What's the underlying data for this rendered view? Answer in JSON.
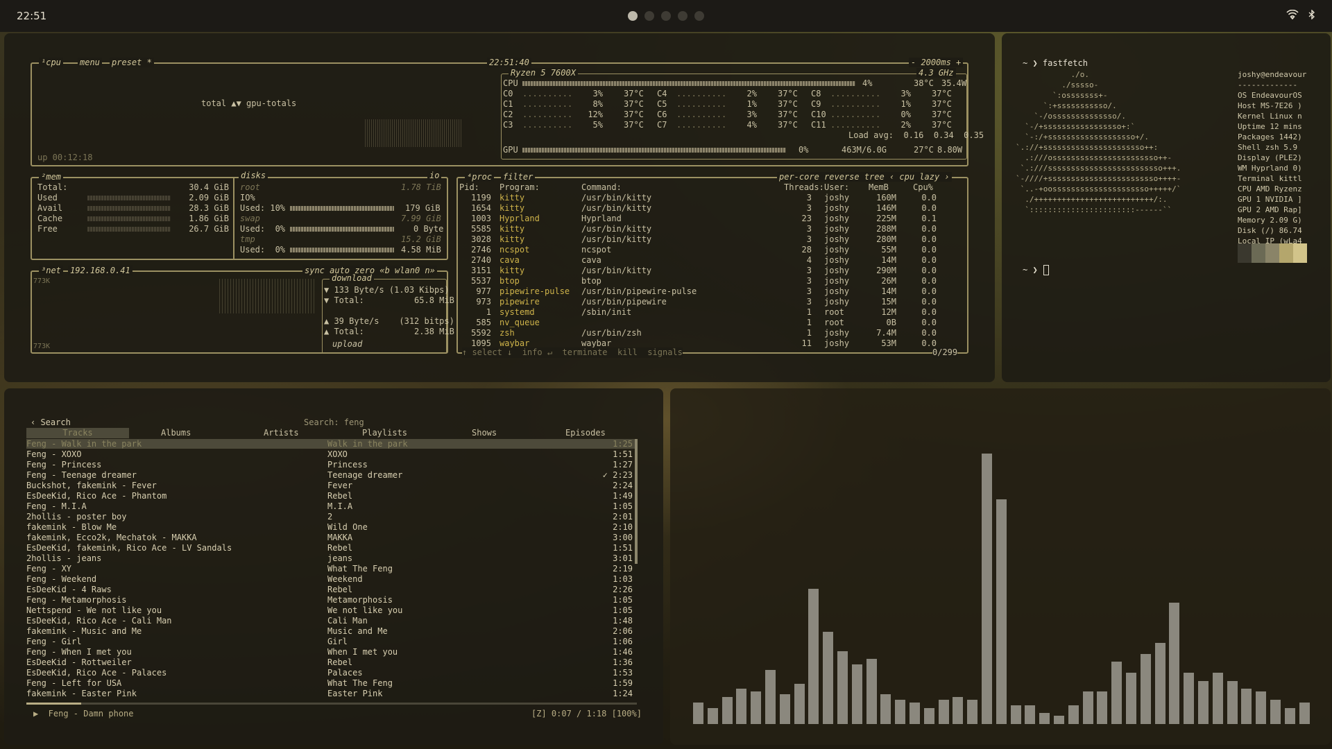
{
  "topbar": {
    "clock": "22:51",
    "workspaces": [
      true,
      false,
      false,
      false,
      false
    ],
    "tray": {
      "wifi": "wifi-icon",
      "bluetooth": "bluetooth-icon"
    }
  },
  "btop": {
    "cpu_tab": "¹cpu",
    "menu_tab": "menu",
    "preset_tab": "preset *",
    "clock": "22:51:40",
    "interval": "- 2000ms +",
    "cpu_model": "Ryzen 5 7600X",
    "freq": "4.3 GHz",
    "uptime": "up 00:12:18",
    "graph_label": "total ▲▼ gpu-totals",
    "cpu_total": {
      "label": "CPU",
      "pct": "4%",
      "temp": "38°C",
      "power": "35.4W",
      "fill": 0.04
    },
    "cores": [
      [
        "C0",
        "3%",
        "37°C"
      ],
      [
        "C1",
        "8%",
        "37°C"
      ],
      [
        "C2",
        "12%",
        "37°C"
      ],
      [
        "C3",
        "5%",
        "37°C"
      ],
      [
        "C4",
        "2%",
        "37°C"
      ],
      [
        "C5",
        "1%",
        "37°C"
      ],
      [
        "C6",
        "3%",
        "37°C"
      ],
      [
        "C7",
        "4%",
        "37°C"
      ],
      [
        "C8",
        "3%",
        "37°C"
      ],
      [
        "C9",
        "1%",
        "37°C"
      ],
      [
        "C10",
        "0%",
        "37°C"
      ],
      [
        "C11",
        "2%",
        "37°C"
      ]
    ],
    "load_avg": "Load avg:  0.16  0.34  0.35",
    "gpu": {
      "label": "GPU",
      "pct": "0%",
      "mem": "463M/6.0G",
      "temp": "27°C",
      "power": "8.80W"
    },
    "mem": {
      "title": "²mem",
      "rows": [
        [
          "Total:",
          "30.4 GiB"
        ],
        [
          "Used",
          "2.09 GiB"
        ],
        [
          "Avail",
          "28.3 GiB"
        ],
        [
          "Cache",
          "1.86 GiB"
        ],
        [
          "Free",
          "26.7 GiB"
        ]
      ]
    },
    "disks": {
      "title": "disks",
      "io": "io",
      "root": "root",
      "root_size": "1.78 TiB",
      "io_label": "IO%",
      "root_used": "Used: 10%",
      "root_used_val": "179 GiB",
      "swap": "swap",
      "swap_size": "7.99 GiB",
      "swap_used": "Used:  0%",
      "swap_used_val": "0 Byte",
      "tmp": "tmp",
      "tmp_size": "15.2 GiB",
      "tmp_used": "Used:  0%",
      "tmp_used_val": "4.58 MiB"
    },
    "net": {
      "title": "³net",
      "ip": "192.168.0.41",
      "tabs": "sync auto zero «b wlan0 n»",
      "scale_top": "773K",
      "scale_bot": "773K",
      "download": "download",
      "dl_rate": "▼ 133 Byte/s (1.03 Kibps)",
      "dl_total": "▼ Total:          65.8 MiB",
      "ul_rate": "▲ 39 Byte/s    (312 bitps)",
      "ul_total": "▲ Total:          2.38 MiB",
      "upload": "upload"
    },
    "proc": {
      "title": "⁴proc",
      "filter": "filter",
      "opts": "per-core  reverse  tree  ‹ cpu lazy ›",
      "headers": [
        "Pid:",
        "Program:",
        "Command:",
        "Threads:",
        "User:",
        "MemB",
        "Cpu%"
      ],
      "rows": [
        [
          "1199",
          "kitty",
          "/usr/bin/kitty",
          "3",
          "joshy",
          "160M",
          "0.0"
        ],
        [
          "1654",
          "kitty",
          "/usr/bin/kitty",
          "3",
          "joshy",
          "146M",
          "0.0"
        ],
        [
          "1003",
          "Hyprland",
          "Hyprland",
          "23",
          "joshy",
          "225M",
          "0.1"
        ],
        [
          "5585",
          "kitty",
          "/usr/bin/kitty",
          "3",
          "joshy",
          "288M",
          "0.0"
        ],
        [
          "3028",
          "kitty",
          "/usr/bin/kitty",
          "3",
          "joshy",
          "280M",
          "0.0"
        ],
        [
          "2746",
          "ncspot",
          "ncspot",
          "28",
          "joshy",
          "55M",
          "0.0"
        ],
        [
          "2740",
          "cava",
          "cava",
          "4",
          "joshy",
          "14M",
          "0.0"
        ],
        [
          "3151",
          "kitty",
          "/usr/bin/kitty",
          "3",
          "joshy",
          "290M",
          "0.0"
        ],
        [
          "5537",
          "btop",
          "btop",
          "3",
          "joshy",
          "26M",
          "0.0"
        ],
        [
          "977",
          "pipewire-pulse",
          "/usr/bin/pipewire-pulse",
          "3",
          "joshy",
          "14M",
          "0.0"
        ],
        [
          "973",
          "pipewire",
          "/usr/bin/pipewire",
          "3",
          "joshy",
          "15M",
          "0.0"
        ],
        [
          "1",
          "systemd",
          "/sbin/init",
          "1",
          "root",
          "12M",
          "0.0"
        ],
        [
          "585",
          "nv_queue",
          "",
          "1",
          "root",
          "0B",
          "0.0"
        ],
        [
          "5592",
          "zsh",
          "/usr/bin/zsh",
          "1",
          "joshy",
          "7.4M",
          "0.0"
        ],
        [
          "1095",
          "waybar",
          "waybar",
          "11",
          "joshy",
          "53M",
          "0.0"
        ]
      ],
      "footer": "↑ select ↓  info ↵  terminate  kill  signals",
      "count": "0/299"
    }
  },
  "fastfetch": {
    "prompt": "~ ❯ fastfetch",
    "prompt2": "~ ❯ ",
    "logo": [
      "            ./o.",
      "          ./sssso-",
      "        `:osssssss+-",
      "      `:+sssssssssso/.",
      "    `-/ossssssssssssso/.",
      "  `-/+sssssssssssssssso+:`",
      "  `-:/+sssssssssssssssssso+/.",
      "`.://+ssssssssssssssssssssso++:",
      "  .:///osssssssssssssssssssssso++-",
      " `.:///sssssssssssssssssssssssso+++.",
      "`-////+ssssssssssssssssssssssso++++-",
      " `..-+oosssssssssssssssssssso+++++/`",
      "  ./++++++++++++++++++++++++++/:.",
      "  `:::::::::::::::::::::::------``"
    ],
    "info": [
      "joshy@endeavour",
      "-------------",
      "OS EndeavourOS",
      "Host MS-7E26 )",
      "Kernel Linux n",
      "Uptime 12 mins",
      "Packages 1442)",
      "Shell zsh 5.9",
      "Display (PLE2)",
      "WM Hyprland 0)",
      "Terminal kittl",
      "CPU AMD Ryzenz",
      "GPU 1 NVIDIA ]",
      "GPU 2 AMD Rap]",
      "Memory 2.09 G)",
      "Disk (/) 86.74",
      "Local IP (wLa4"
    ]
  },
  "spotify": {
    "back": "‹ Search",
    "search": "Search: feng",
    "tabs": [
      "Tracks",
      "Albums",
      "Artists",
      "Playlists",
      "Shows",
      "Episodes"
    ],
    "tracks": [
      [
        "Feng - Walk in the park",
        "Walk in the park",
        "1:25"
      ],
      [
        "Feng - XOXO",
        "XOXO",
        "1:51"
      ],
      [
        "Feng - Princess",
        "Princess",
        "1:27"
      ],
      [
        "Feng - Teenage dreamer",
        "Teenage dreamer",
        "✓ 2:23"
      ],
      [
        "Buckshot, fakemink - Fever",
        "Fever",
        "2:24"
      ],
      [
        "EsDeeKid, Rico Ace - Phantom",
        "Rebel",
        "1:49"
      ],
      [
        "Feng - M.I.A",
        "M.I.A",
        "1:05"
      ],
      [
        "2hollis - poster boy",
        "2",
        "2:01"
      ],
      [
        "fakemink - Blow Me",
        "Wild One",
        "2:10"
      ],
      [
        "fakemink, Ecco2k, Mechatok - MAKKA",
        "MAKKA",
        "3:00"
      ],
      [
        "EsDeeKid, fakemink, Rico Ace - LV Sandals",
        "Rebel",
        "1:51"
      ],
      [
        "2hollis - jeans",
        "jeans",
        "3:01"
      ],
      [
        "Feng - XY",
        "What The Feng",
        "2:19"
      ],
      [
        "Feng - Weekend",
        "Weekend",
        "1:03"
      ],
      [
        "EsDeeKid - 4 Raws",
        "Rebel",
        "2:26"
      ],
      [
        "Feng - Metamorphosis",
        "Metamorphosis",
        "1:05"
      ],
      [
        "Nettspend - We not like you",
        "We not like you",
        "1:05"
      ],
      [
        "EsDeeKid, Rico Ace - Cali Man",
        "Cali Man",
        "1:48"
      ],
      [
        "fakemink - Music and Me",
        "Music and Me",
        "2:06"
      ],
      [
        "Feng - Girl",
        "Girl",
        "1:06"
      ],
      [
        "Feng - When I met you",
        "When I met you",
        "1:46"
      ],
      [
        "EsDeeKid - Rottweiler",
        "Rebel",
        "1:36"
      ],
      [
        "EsDeeKid, Rico Ace - Palaces",
        "Palaces",
        "1:53"
      ],
      [
        "Feng - Left for USA",
        "What The Feng",
        "1:59"
      ],
      [
        "fakemink - Easter Pink",
        "Easter Pink",
        "1:24"
      ]
    ],
    "now_playing": "▶  Feng - Damn phone",
    "status": "[Z] 0:07 / 1:18 [100%]",
    "progress": 0.09
  },
  "cava": {
    "levels": [
      0.08,
      0.06,
      0.1,
      0.13,
      0.12,
      0.2,
      0.11,
      0.15,
      0.5,
      0.34,
      0.27,
      0.22,
      0.24,
      0.11,
      0.09,
      0.08,
      0.06,
      0.09,
      0.1,
      0.09,
      1.0,
      0.83,
      0.07,
      0.07,
      0.04,
      0.03,
      0.07,
      0.12,
      0.12,
      0.23,
      0.19,
      0.26,
      0.3,
      0.45,
      0.19,
      0.16,
      0.19,
      0.16,
      0.13,
      0.12,
      0.09,
      0.06,
      0.08
    ]
  }
}
